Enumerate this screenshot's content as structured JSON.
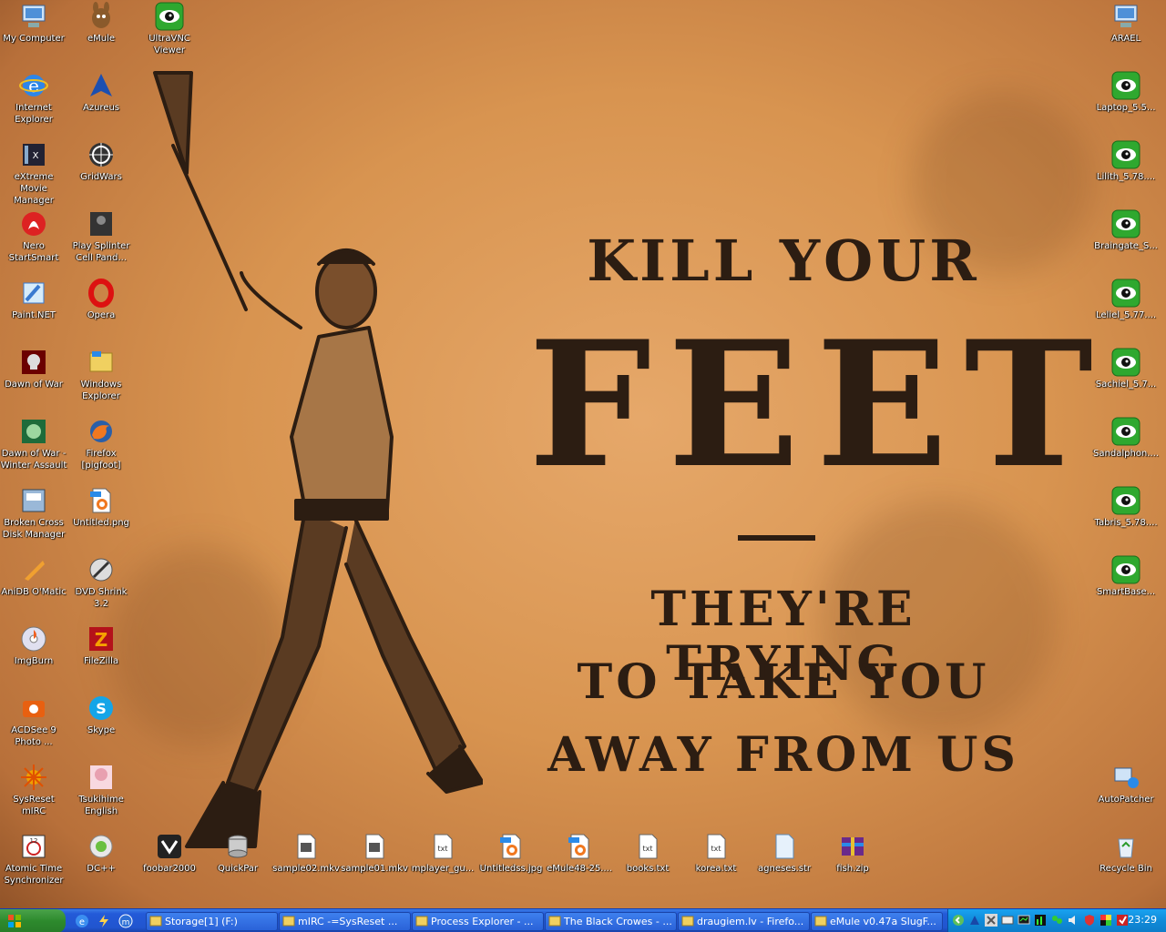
{
  "wallpaper": {
    "line1": "KILL YOUR",
    "line2": "FEET",
    "line3": "THEY'RE TRYING",
    "line4": "TO TAKE YOU",
    "line5": "AWAY FROM US"
  },
  "desktop": {
    "left_col1": [
      {
        "label": "My Computer",
        "icon": "my-computer-icon"
      },
      {
        "label": "Internet Explorer",
        "icon": "internet-explorer-icon"
      },
      {
        "label": "eXtreme Movie Manager",
        "icon": "movie-manager-icon"
      },
      {
        "label": "Nero StartSmart",
        "icon": "nero-icon"
      },
      {
        "label": "Paint.NET",
        "icon": "paint-net-icon"
      },
      {
        "label": "Dawn of War",
        "icon": "dawn-of-war-icon"
      },
      {
        "label": "Dawn of War - Winter Assault",
        "icon": "winter-assault-icon"
      },
      {
        "label": "Broken Cross Disk Manager",
        "icon": "disk-manager-icon"
      },
      {
        "label": "AniDB O'Matic",
        "icon": "anidb-icon"
      },
      {
        "label": "ImgBurn",
        "icon": "imgburn-icon"
      },
      {
        "label": "ACDSee 9 Photo ...",
        "icon": "acdsee-icon"
      },
      {
        "label": "SysReset mIRC",
        "icon": "sysreset-icon"
      },
      {
        "label": "Atomic Time Synchronizer",
        "icon": "atomic-time-icon"
      }
    ],
    "left_col2": [
      {
        "label": "eMule",
        "icon": "emule-icon"
      },
      {
        "label": "Azureus",
        "icon": "azureus-icon"
      },
      {
        "label": "GridWars",
        "icon": "gridwars-icon"
      },
      {
        "label": "Play Splinter Cell Pand...",
        "icon": "splinter-cell-icon"
      },
      {
        "label": "Opera",
        "icon": "opera-icon"
      },
      {
        "label": "Windows Explorer",
        "icon": "windows-explorer-icon"
      },
      {
        "label": "Firefox [pigfoot]",
        "icon": "firefox-icon"
      },
      {
        "label": "Untitled.png",
        "icon": "png-file-icon"
      },
      {
        "label": "DVD Shrink 3.2",
        "icon": "dvd-shrink-icon"
      },
      {
        "label": "FileZilla",
        "icon": "filezilla-icon"
      },
      {
        "label": "Skype",
        "icon": "skype-icon"
      },
      {
        "label": "Tsukihime English",
        "icon": "tsukihime-icon"
      },
      {
        "label": "DC++",
        "icon": "dcpp-icon"
      }
    ],
    "left_col3": [
      {
        "label": "UltraVNC Viewer",
        "icon": "ultravnc-icon"
      }
    ],
    "bottom_row": [
      {
        "label": "foobar2000",
        "icon": "foobar-icon"
      },
      {
        "label": "QuickPar",
        "icon": "quickpar-icon"
      },
      {
        "label": "sample02.mkv",
        "icon": "mkv-file-icon"
      },
      {
        "label": "sample01.mkv",
        "icon": "mkv-file-icon"
      },
      {
        "label": "mplayer_gu...",
        "icon": "txt-file-icon"
      },
      {
        "label": "Untitledss.jpg",
        "icon": "jpg-file-icon"
      },
      {
        "label": "eMule48-25....",
        "icon": "ico-file-icon"
      },
      {
        "label": "books.txt",
        "icon": "txt-file-icon"
      },
      {
        "label": "korea.txt",
        "icon": "txt-file-icon"
      },
      {
        "label": "agneses.str",
        "icon": "str-file-icon"
      },
      {
        "label": "fish.zip",
        "icon": "zip-file-icon"
      }
    ],
    "right_col": [
      {
        "label": "ARAEL",
        "icon": "network-computer-icon"
      },
      {
        "label": "Laptop_5.5...",
        "icon": "vnc-connection-icon"
      },
      {
        "label": "Lilith_5.78....",
        "icon": "vnc-connection-icon"
      },
      {
        "label": "Braingate_S...",
        "icon": "vnc-connection-icon"
      },
      {
        "label": "Leliel_5.77....",
        "icon": "vnc-connection-icon"
      },
      {
        "label": "Sachiel_5.7...",
        "icon": "vnc-connection-icon"
      },
      {
        "label": "Sandalphon....",
        "icon": "vnc-connection-icon"
      },
      {
        "label": "Tabris_5.78....",
        "icon": "vnc-connection-icon"
      },
      {
        "label": "SmartBase...",
        "icon": "vnc-connection-icon"
      }
    ],
    "right_bottom": [
      {
        "label": "AutoPatcher",
        "icon": "autopatcher-icon"
      },
      {
        "label": "Recycle Bin",
        "icon": "recycle-bin-icon"
      }
    ]
  },
  "taskbar": {
    "tasks": [
      {
        "label": "Storage[1] (F:)",
        "icon": "folder-icon"
      },
      {
        "label": "mIRC -=SysReset ...",
        "icon": "mirc-icon"
      },
      {
        "label": "Process Explorer - ...",
        "icon": "process-explorer-icon"
      },
      {
        "label": "The Black Crowes - ...",
        "icon": "foobar-icon"
      },
      {
        "label": "draugiem.lv - Firefo...",
        "icon": "firefox-icon"
      },
      {
        "label": "eMule v0.47a SlugF...",
        "icon": "emule-icon"
      }
    ],
    "clock": "23:29"
  },
  "colors": {
    "taskbar_blue": "#2155cf",
    "start_green": "#2d8a2d",
    "tray_blue": "#108ad8",
    "vnc_green": "#3cb83c"
  }
}
